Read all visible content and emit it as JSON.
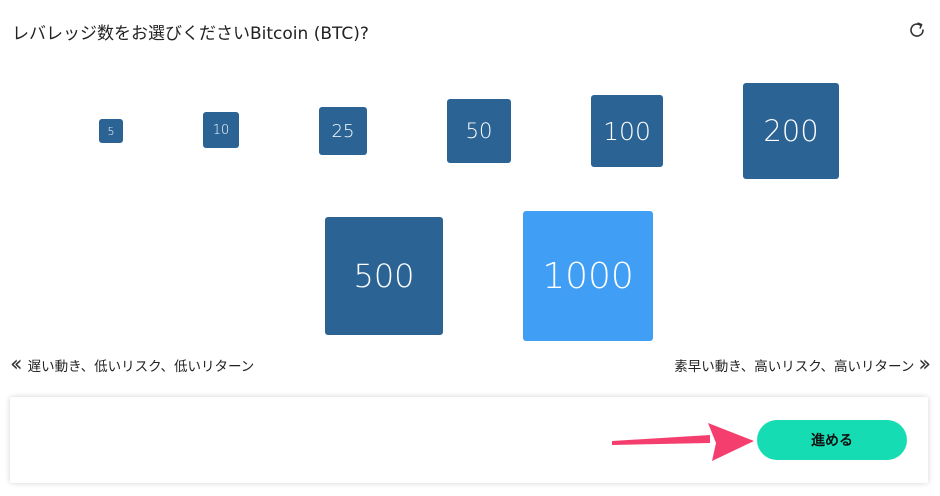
{
  "question": "レバレッジ数をお選びくださいBitcoin (BTC)?",
  "refresh_icon": "refresh-icon",
  "leverage_options": [
    "5",
    "10",
    "25",
    "50",
    "100",
    "200",
    "500",
    "1000"
  ],
  "selected_leverage": "1000",
  "hint_left": "遅い動き、低いリスク、低いリターン",
  "hint_right": "素早い動き、高いリスク、高いリターン",
  "next_button": "進める",
  "colors": {
    "option": "#2a6394",
    "option_selected": "#419ef5",
    "next_button": "#16dcb4",
    "annotation_arrow": "#f43f6e"
  }
}
